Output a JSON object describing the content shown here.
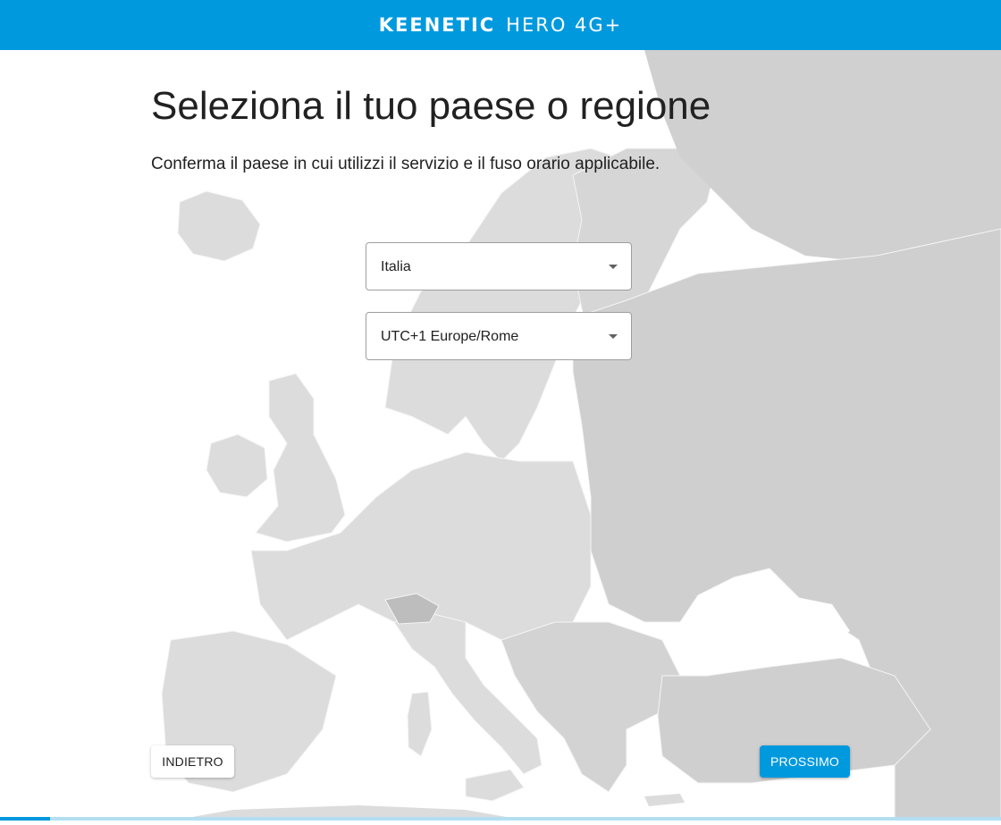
{
  "header": {
    "brand": "KEENETIC",
    "model": "HERO 4G+"
  },
  "page": {
    "title": "Seleziona il tuo paese o regione",
    "subtitle": "Conferma il paese in cui utilizzi il servizio e il fuso orario applicabile."
  },
  "country_select": {
    "value": "Italia"
  },
  "timezone_select": {
    "value": "UTC+1 Europe/Rome"
  },
  "buttons": {
    "back": "INDIETRO",
    "next": "PROSSIMO"
  },
  "progress": {
    "fraction": 0.05
  },
  "colors": {
    "accent": "#0199de",
    "map_land": "#dcdcdc",
    "map_east": "#cfcfcf",
    "map_border": "#f5f5f5"
  }
}
